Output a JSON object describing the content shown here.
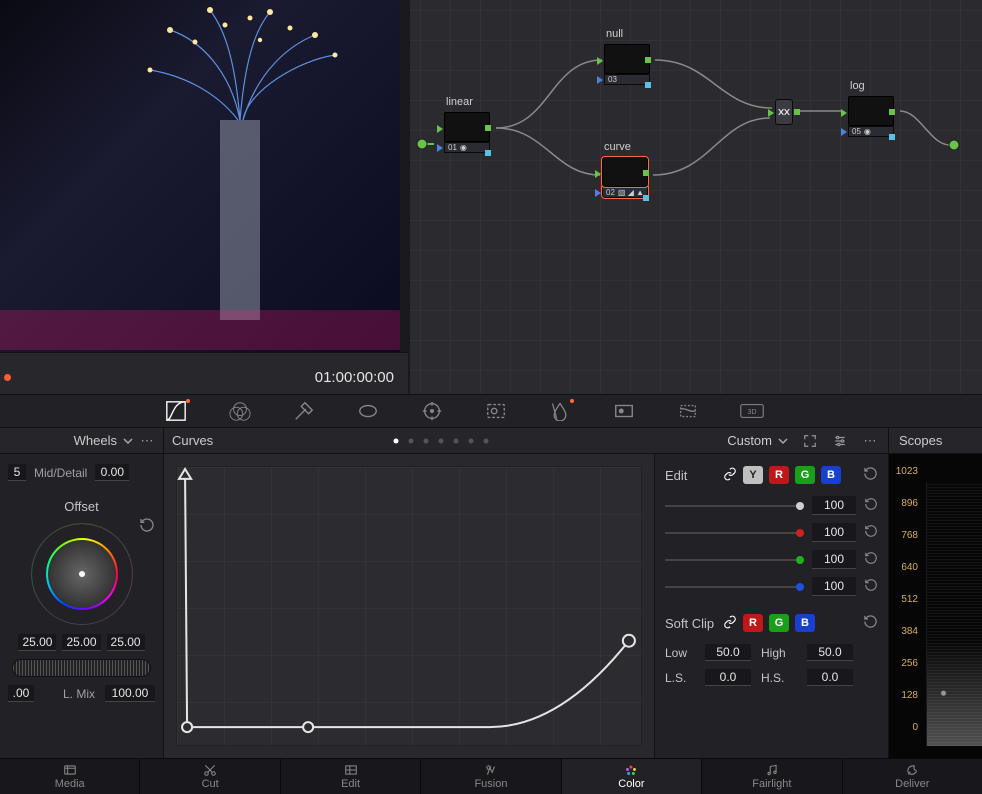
{
  "viewer": {
    "timecode": "01:00:00:00"
  },
  "nodes": {
    "linear": {
      "label": "linear",
      "num": "01"
    },
    "null": {
      "label": "null",
      "num": "03"
    },
    "curve": {
      "label": "curve",
      "num": "02"
    },
    "log": {
      "label": "log",
      "num": "05"
    }
  },
  "panels": {
    "wheels": "Wheels",
    "curves": "Curves",
    "custom": "Custom",
    "scopes": "Scopes"
  },
  "wheels": {
    "mid_label": "Mid/Detail",
    "mid_val": "0.00",
    "left_small": "5",
    "offset_label": "Offset",
    "vals": [
      "25.00",
      "25.00",
      "25.00"
    ],
    "bottom_left": ".00",
    "lmix_label": "L. Mix",
    "lmix_val": "100.00"
  },
  "edit": {
    "edit_label": "Edit",
    "softclip_label": "Soft Clip",
    "channels": {
      "y": "Y",
      "r": "R",
      "g": "G",
      "b": "B"
    },
    "sliders": {
      "y": "100",
      "r": "100",
      "g": "100",
      "b": "100"
    },
    "low_label": "Low",
    "low_val": "50.0",
    "high_label": "High",
    "high_val": "50.0",
    "ls_label": "L.S.",
    "ls_val": "0.0",
    "hs_label": "H.S.",
    "hs_val": "0.0"
  },
  "scopes": {
    "ticks": [
      "1023",
      "896",
      "768",
      "640",
      "512",
      "384",
      "256",
      "128",
      "0"
    ]
  },
  "pages": {
    "media": "Media",
    "cut": "Cut",
    "edit": "Edit",
    "fusion": "Fusion",
    "color": "Color",
    "fairlight": "Fairlight",
    "deliver": "Deliver"
  }
}
